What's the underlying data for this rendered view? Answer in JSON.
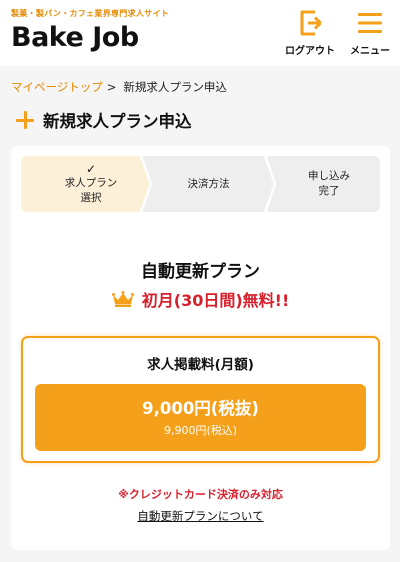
{
  "header": {
    "tagline": "製菓・製パン・カフェ業界専門求人サイト",
    "logo_text": "Bake Job",
    "logout_label": "ログアウト",
    "menu_label": "メニュー"
  },
  "breadcrumb": {
    "home": "マイページトップ",
    "separator": ">",
    "current": "新規求人プラン申込"
  },
  "page_title": "新規求人プラン申込",
  "steps": [
    {
      "line1": "求人プラン",
      "line2": "選択",
      "status": "completed"
    },
    {
      "line1": "決済方法",
      "line2": "",
      "status": "upcoming"
    },
    {
      "line1": "申し込み",
      "line2": "完了",
      "status": "upcoming"
    }
  ],
  "plan": {
    "name": "自動更新プラン",
    "promo": "初月(30日間)無料!!"
  },
  "fee": {
    "title": "求人掲載料(月額)",
    "price_excl": "9,000円(税抜)",
    "price_incl": "9,900円(税込)"
  },
  "note": "※クレジットカード決済のみ対応",
  "about_link": "自動更新プランについて",
  "colors": {
    "accent": "#f5a01a",
    "accent_text": "#e58a00",
    "alert": "#d7202c",
    "step_active_bg": "#fdf0d9",
    "step_inactive_bg": "#eeeeee"
  },
  "icons": {
    "logout": "logout-icon",
    "menu": "hamburger-menu-icon",
    "plus": "plus-icon",
    "check": "check-icon",
    "crown": "crown-icon"
  }
}
